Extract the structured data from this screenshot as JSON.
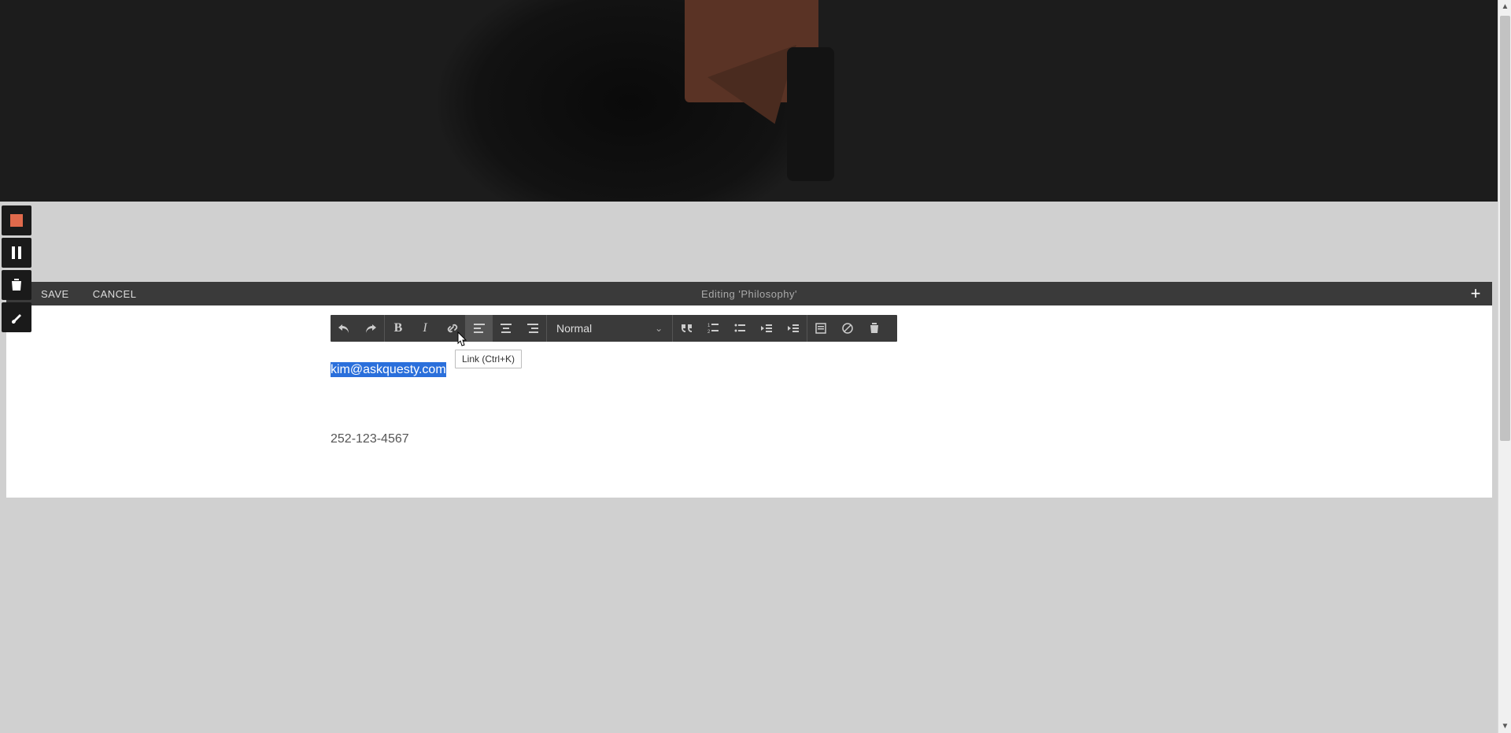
{
  "edit_header": {
    "save_label": "SAVE",
    "cancel_label": "CANCEL",
    "editing_title": "Editing 'Philosophy'",
    "add_label": "+"
  },
  "toolbar": {
    "format_selected": "Normal",
    "tooltip": "Link (Ctrl+K)"
  },
  "content": {
    "selected_email": "kim@askquesty.com",
    "phone": "252-123-4567"
  },
  "icons": {
    "record": "record",
    "pause": "pause",
    "trash": "trash",
    "brush": "brush"
  }
}
